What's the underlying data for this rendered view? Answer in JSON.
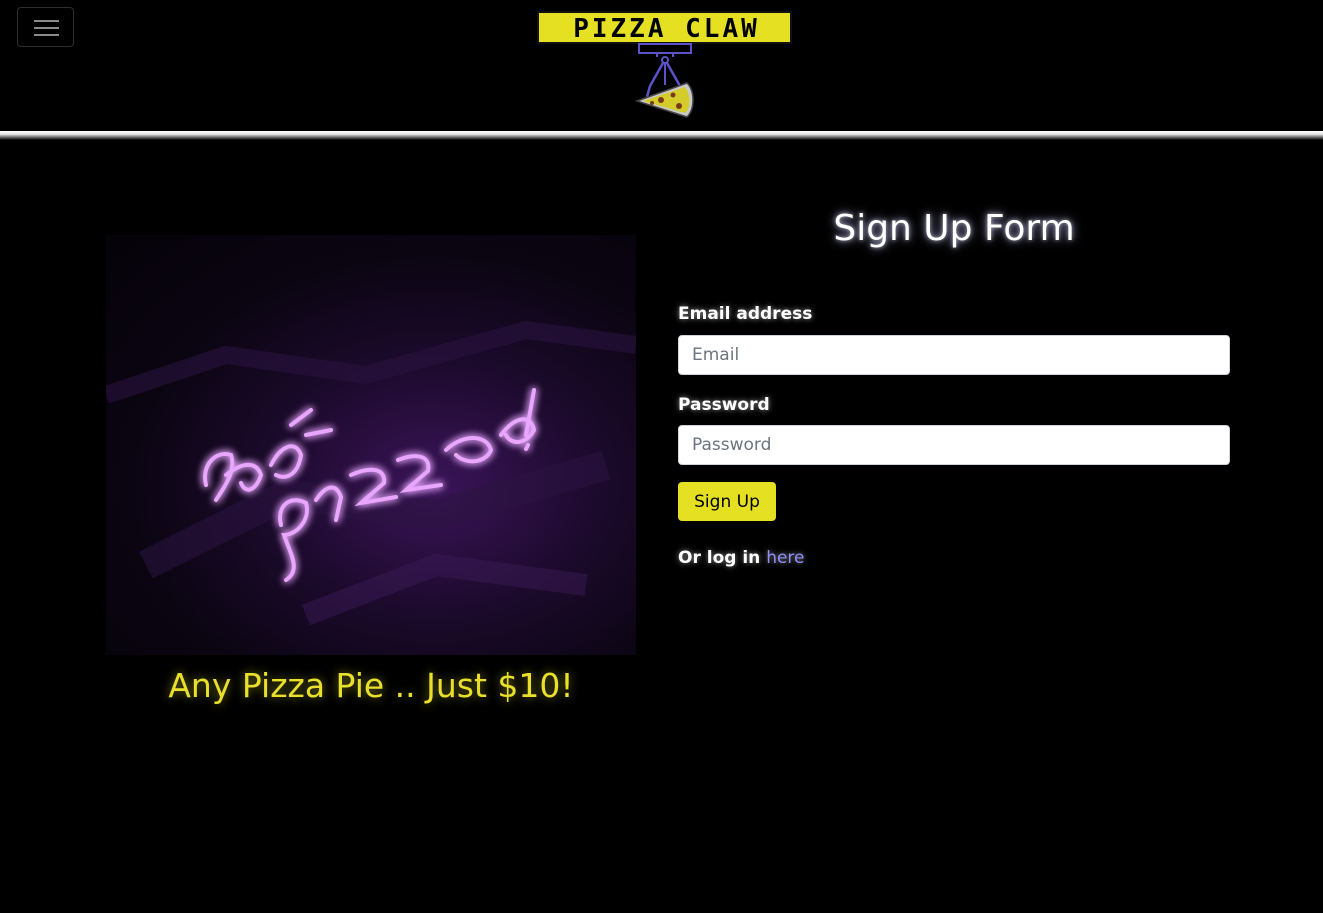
{
  "navbar": {
    "toggle_icon": "hamburger-menu-icon",
    "logo_text": "PIZZA CLAW",
    "logo_icon": "claw-grabbing-pizza-icon",
    "colors": {
      "logo_yellow": "#e6e022",
      "claw_purple": "#5b52c8"
    }
  },
  "promo": {
    "image_icon": "neon-hot-pizza-sign-image",
    "caption": "Any Pizza Pie .. Just $10!",
    "caption_color": "#e8e02a"
  },
  "form": {
    "title": "Sign Up Form",
    "email_label": "Email address",
    "email_placeholder": "Email",
    "email_value": "",
    "password_label": "Password",
    "password_placeholder": "Password",
    "password_value": "",
    "submit_label": "Sign Up",
    "submit_color": "#e6e022",
    "login_prefix": "Or log in",
    "login_link_text": "here",
    "link_color": "#8f8fff"
  }
}
